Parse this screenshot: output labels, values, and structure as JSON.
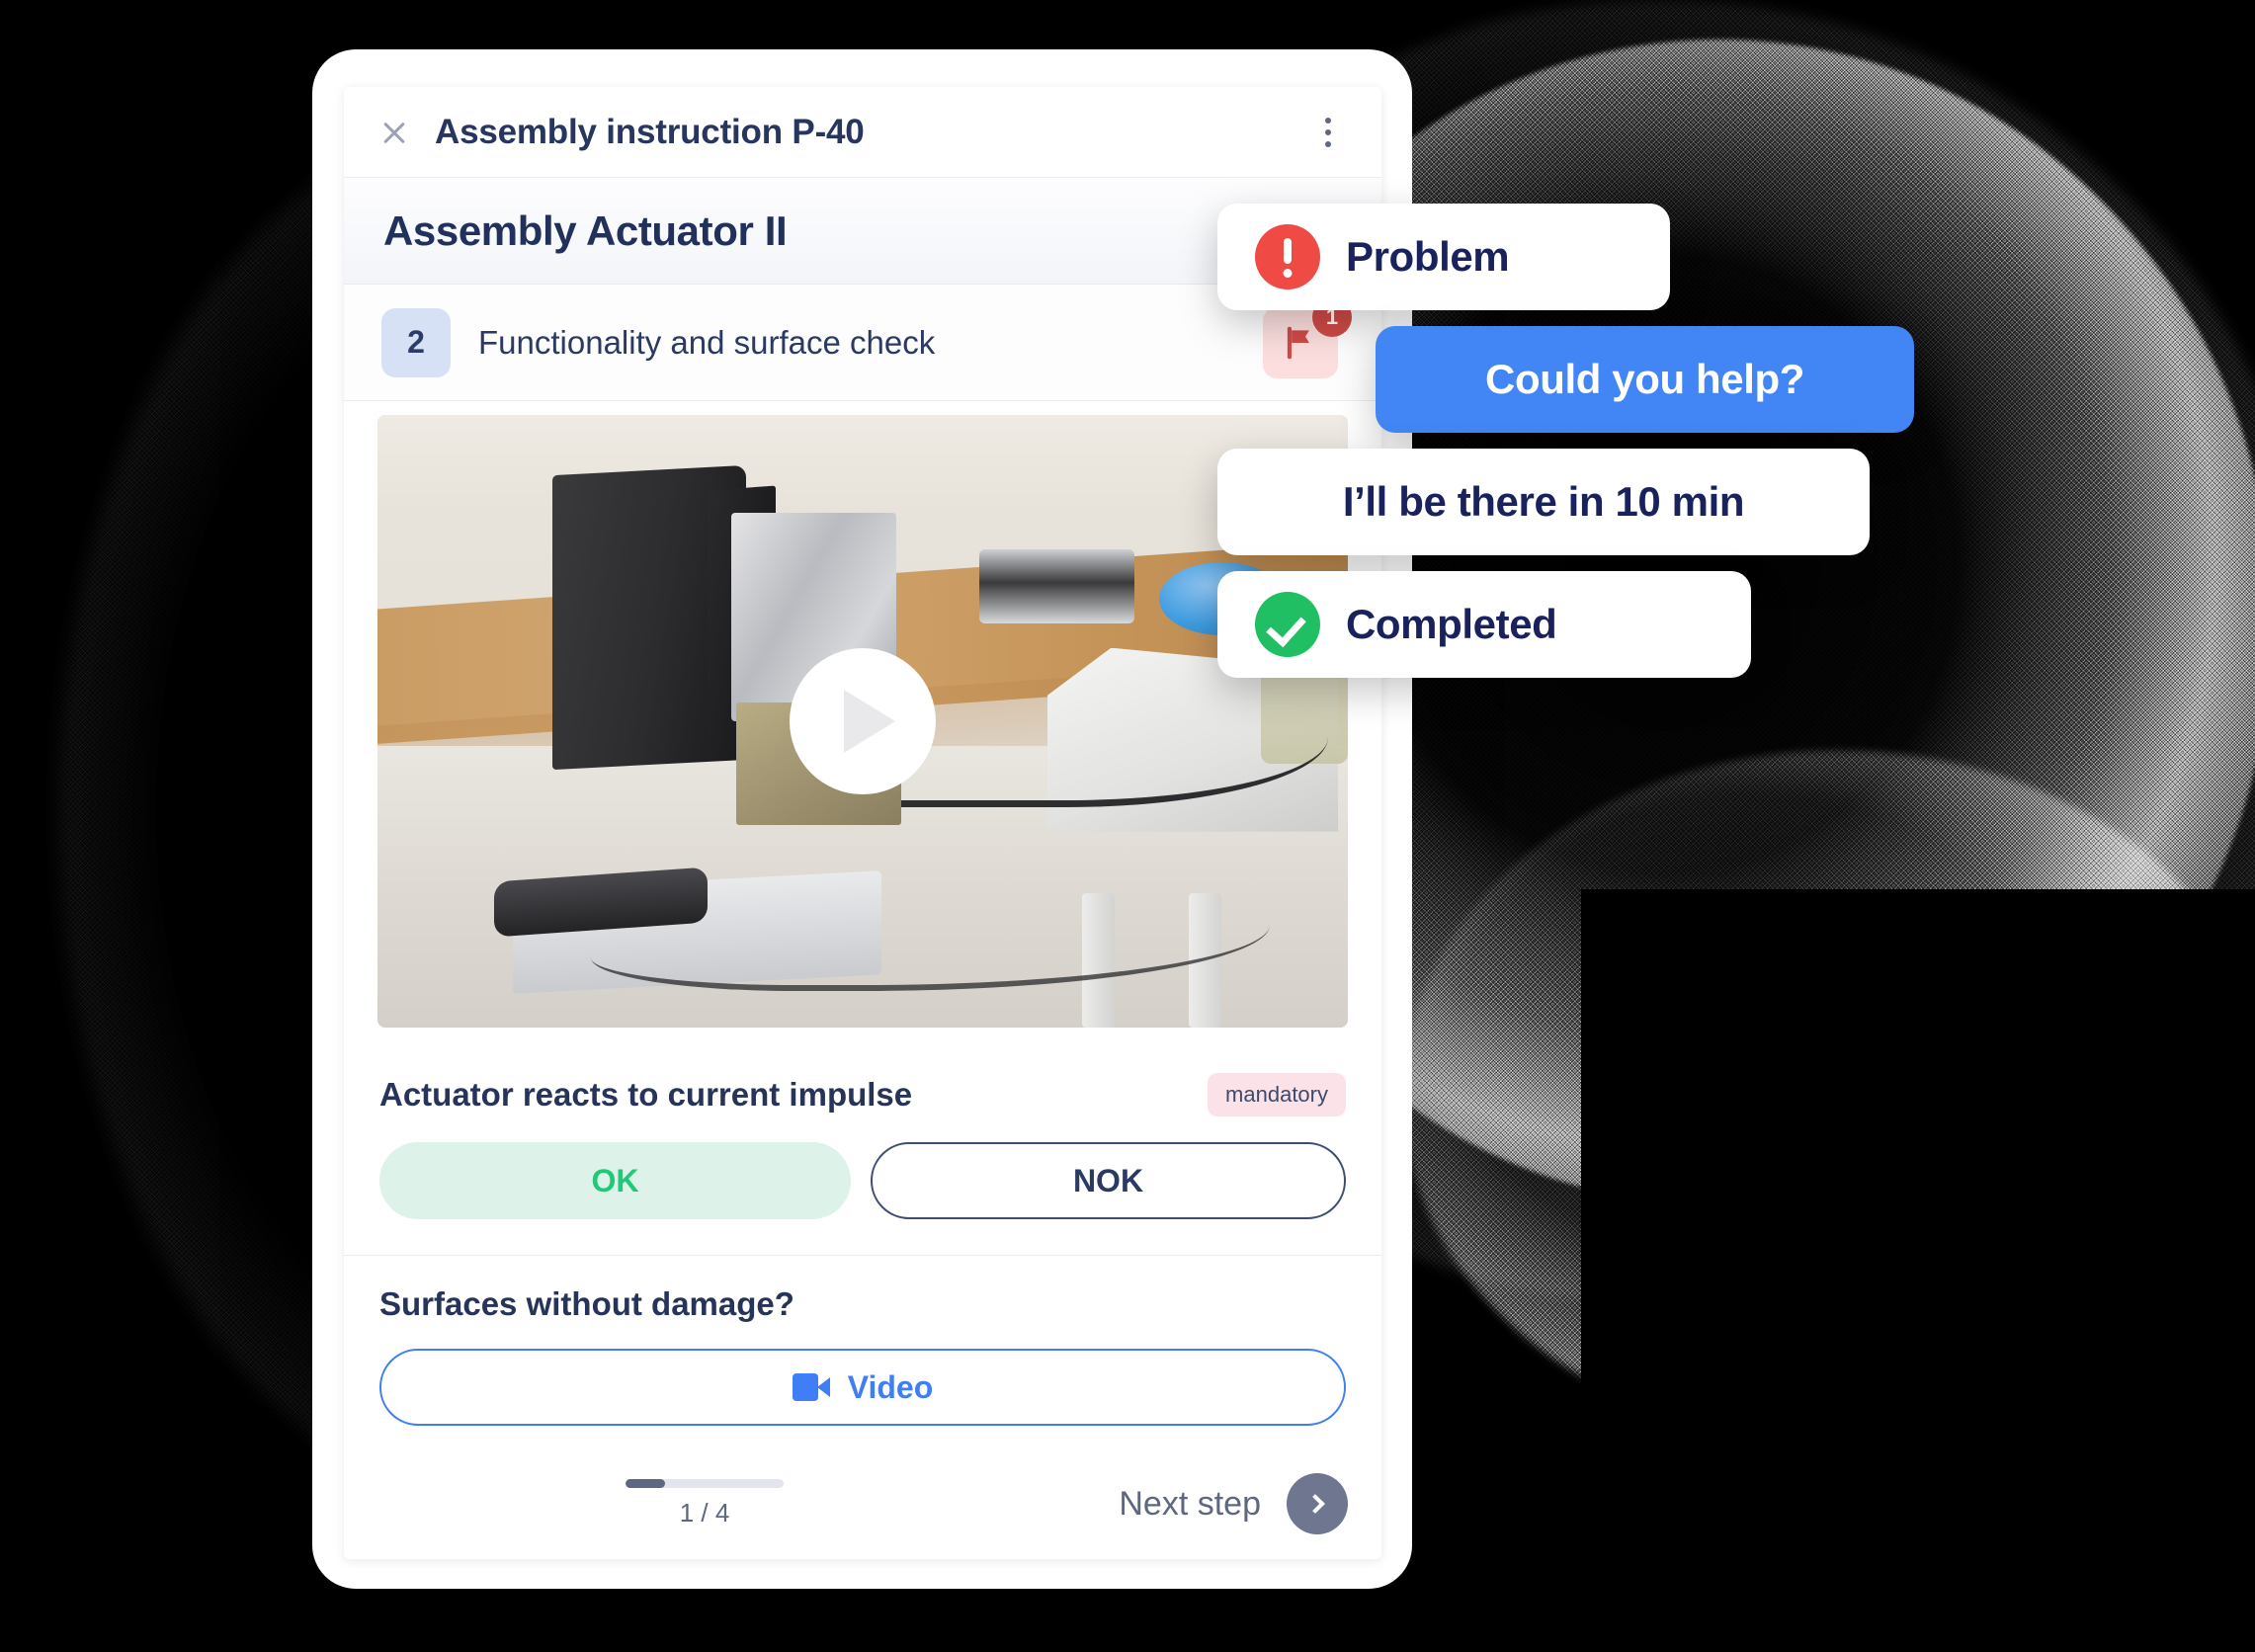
{
  "window": {
    "close_icon": "close-icon",
    "title": "Assembly instruction P-40",
    "menu_icon": "kebab-menu-icon"
  },
  "section": {
    "heading": "Assembly Actuator II"
  },
  "step": {
    "number": "2",
    "title": "Functionality and surface check",
    "flag_icon": "flag-icon",
    "flag_badge_count": "1"
  },
  "video": {
    "play_icon": "play-icon",
    "alt": "Actuator assembly workbench video"
  },
  "checks": [
    {
      "label": "Actuator reacts to current impulse",
      "badge": "mandatory",
      "ok_label": "OK",
      "nok_label": "NOK"
    },
    {
      "label": "Surfaces without damage?",
      "video_label": "Video",
      "video_icon": "video-camera-icon"
    }
  ],
  "footer": {
    "progress_text": "1 / 4",
    "progress_percent": 25,
    "next_label": "Next step",
    "next_icon": "chevron-right-icon"
  },
  "notifications": [
    {
      "id": "problem",
      "label": "Problem",
      "icon": "exclamation-circle-icon",
      "color": "#f04a45"
    },
    {
      "id": "help",
      "label": "Could you help?",
      "icon": "none",
      "color": "#4285f4"
    },
    {
      "id": "eta",
      "label": "I’ll be there in 10 min",
      "icon": "none",
      "color": "#ffffff"
    },
    {
      "id": "completed",
      "label": "Completed",
      "icon": "check-circle-icon",
      "color": "#21bf63"
    }
  ]
}
